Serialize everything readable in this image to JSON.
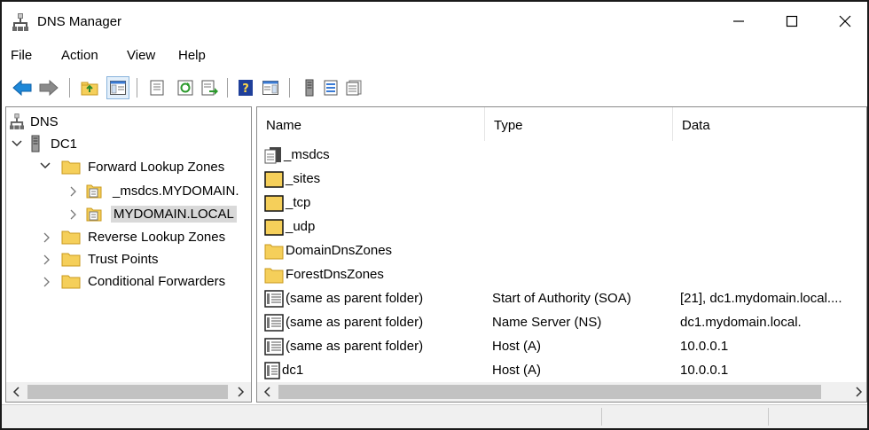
{
  "window": {
    "title": "DNS Manager"
  },
  "menu": [
    "File",
    "Action",
    "View",
    "Help"
  ],
  "toolbar": {
    "buttons": [
      "back-icon",
      "forward-icon",
      "up-folder-icon",
      "show-hide-tree-icon",
      "properties-icon",
      "refresh-icon",
      "export-list-icon",
      "help-icon",
      "show-hide-action-pane-icon",
      "server-icon",
      "record-list-icon",
      "properties-sheet-icon"
    ]
  },
  "tree": {
    "root": "DNS",
    "server": "DC1",
    "forward_zones": "Forward Lookup Zones",
    "zone_msdcs": "_msdcs.MYDOMAIN.",
    "zone_mydomain": "MYDOMAIN.LOCAL",
    "reverse_zones": "Reverse Lookup Zones",
    "trust_points": "Trust Points",
    "conditional_forwarders": "Conditional Forwarders"
  },
  "list": {
    "headers": {
      "name": "Name",
      "type": "Type",
      "data": "Data"
    },
    "rows": [
      {
        "name": "_msdcs",
        "type": "",
        "data": "",
        "icon": "zone-file-icon"
      },
      {
        "name": "_sites",
        "type": "",
        "data": "",
        "icon": "folder-icon"
      },
      {
        "name": "_tcp",
        "type": "",
        "data": "",
        "icon": "folder-icon"
      },
      {
        "name": "_udp",
        "type": "",
        "data": "",
        "icon": "folder-icon"
      },
      {
        "name": "DomainDnsZones",
        "type": "",
        "data": "",
        "icon": "folder-icon"
      },
      {
        "name": "ForestDnsZones",
        "type": "",
        "data": "",
        "icon": "folder-icon"
      },
      {
        "name": "(same as parent folder)",
        "type": "Start of Authority (SOA)",
        "data": "[21], dc1.mydomain.local....",
        "icon": "record-icon"
      },
      {
        "name": "(same as parent folder)",
        "type": "Name Server (NS)",
        "data": "dc1.mydomain.local.",
        "icon": "record-icon"
      },
      {
        "name": "(same as parent folder)",
        "type": "Host (A)",
        "data": "10.0.0.1",
        "icon": "record-icon"
      },
      {
        "name": "dc1",
        "type": "Host (A)",
        "data": "10.0.0.1",
        "icon": "record-icon"
      }
    ]
  },
  "colors": {
    "folder": "#f5cf5a",
    "folder_edge": "#c99a1d",
    "selection": "#d9d9d9",
    "back_arrow": "#1e88d8"
  }
}
